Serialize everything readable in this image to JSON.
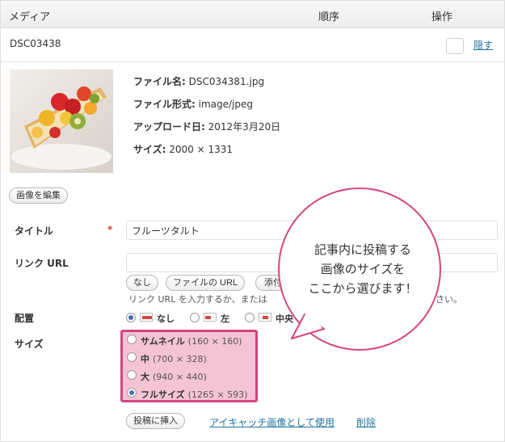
{
  "header": {
    "media": "メディア",
    "order": "順序",
    "action": "操作"
  },
  "item": {
    "filename": "DSC03438",
    "hide_label": "隠す"
  },
  "meta": {
    "file_name_label": "ファイル名:",
    "file_name": "DSC034381.jpg",
    "file_type_label": "ファイル形式:",
    "file_type": "image/jpeg",
    "upload_date_label": "アップロード日:",
    "upload_date": "2012年3月20日",
    "size_label": "サイズ:",
    "size": "2000 × 1331"
  },
  "edit_image_label": "画像を編集",
  "form": {
    "title_label": "タイトル",
    "required_mark": "*",
    "title_value": "フルーツタルト",
    "link_label": "リンク URL",
    "link_value": "",
    "link_buttons": {
      "none": "なし",
      "file_url": "ファイルの URL",
      "attachment": "添付"
    },
    "link_help": "リンク URL を入力するか、または",
    "link_help_tail": "さい。",
    "align_label": "配置",
    "align_options": [
      "なし",
      "左",
      "中央"
    ],
    "align_selected": "なし",
    "size_label": "サイズ",
    "size_options": [
      {
        "name": "サムネイル",
        "dims": "(160 × 160)"
      },
      {
        "name": "中",
        "dims": "(700 × 328)"
      },
      {
        "name": "大",
        "dims": "(940 × 440)"
      },
      {
        "name": "フルサイズ",
        "dims": "(1265 × 593)"
      }
    ],
    "size_selected": "フルサイズ"
  },
  "actions": {
    "insert": "投稿に挿入",
    "featured": "アイキャッチ画像として使用",
    "delete": "削除"
  },
  "callout": {
    "line1": "記事内に投稿する",
    "line2": "画像のサイズを",
    "line3": "ここから選びます！"
  },
  "colors": {
    "link": "#21759b",
    "highlight_border": "#d4457f",
    "highlight_fill": "#f5c3d6",
    "required": "#d54e21"
  }
}
